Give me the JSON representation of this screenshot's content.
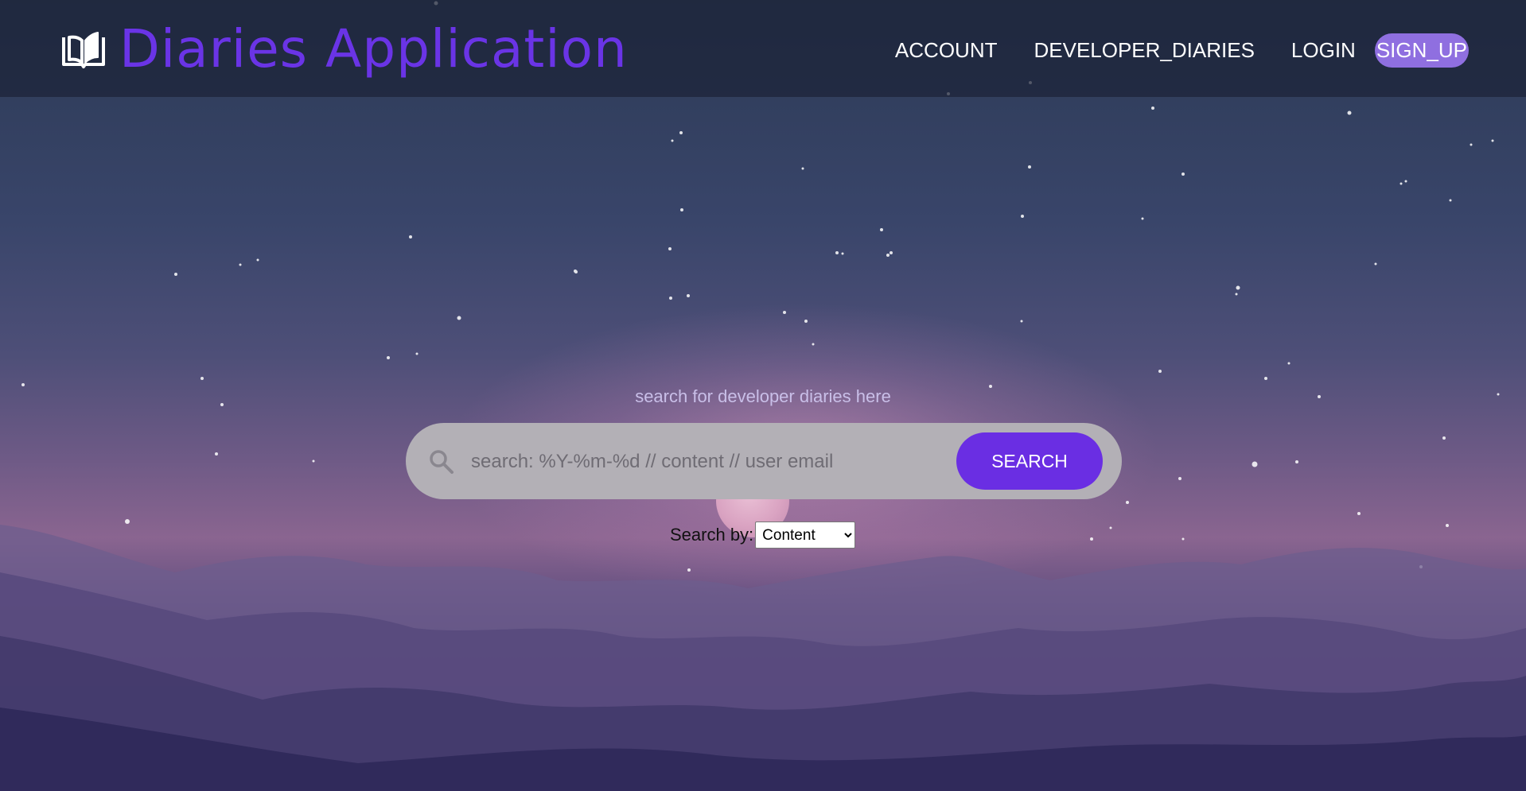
{
  "app": {
    "title": "Diaries Application",
    "brand_color": "#6a34e6",
    "icon": "open-book-icon"
  },
  "nav": {
    "items": [
      {
        "label": "ACCOUNT"
      },
      {
        "label": "DEVELOPER_DIARIES"
      },
      {
        "label": "LOGIN"
      },
      {
        "label": "SIGN_UP"
      }
    ],
    "signup_bg": "#8f6fe0"
  },
  "search": {
    "hint": "search for developer diaries here",
    "placeholder": "search: %Y-%m-%d // content // user email",
    "button_label": "SEARCH",
    "button_color": "#6a2ee3",
    "icon": "magnifier-icon",
    "by_label": "Search by:",
    "by_selected": "Content"
  }
}
